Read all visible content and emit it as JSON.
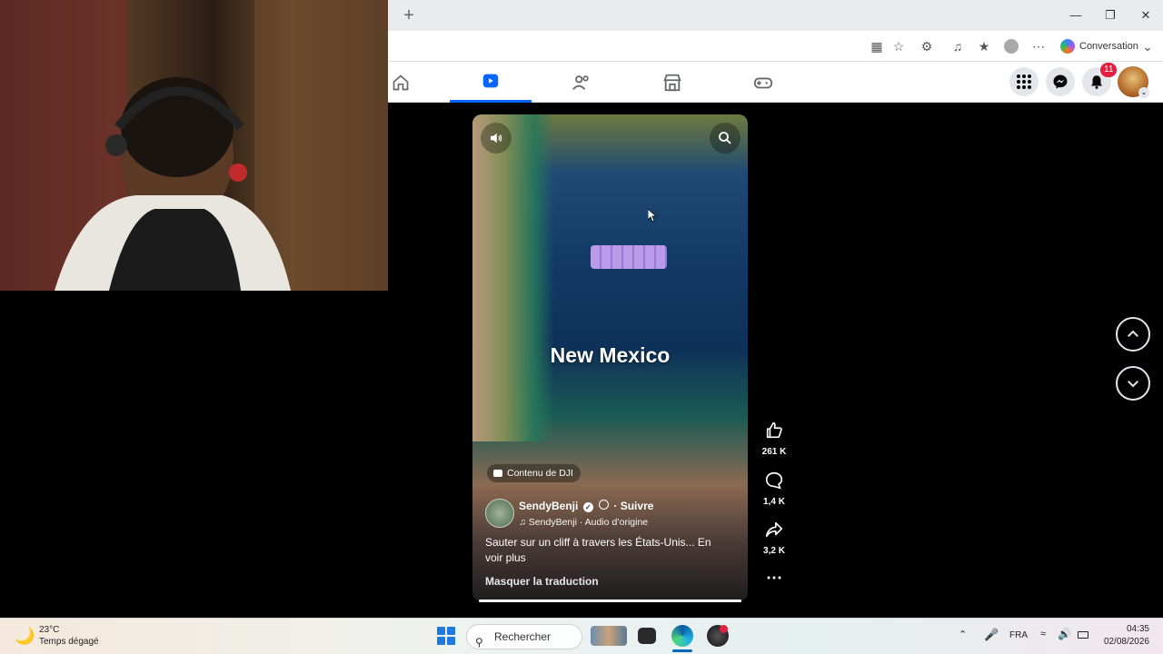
{
  "browser": {
    "new_tab_label": "+",
    "copilot_label": "Conversation",
    "window_controls": [
      "minimize-icon",
      "restore-icon",
      "close-icon"
    ]
  },
  "facebook": {
    "nav_tabs": [
      {
        "name": "home-icon",
        "active": false
      },
      {
        "name": "reels-icon",
        "active": true
      },
      {
        "name": "friends-icon",
        "active": false
      },
      {
        "name": "marketplace-icon",
        "active": false
      },
      {
        "name": "gaming-icon",
        "active": false
      }
    ],
    "notifications_count": "11",
    "accent": "#0866ff"
  },
  "reel": {
    "overlay_text": "New Mexico",
    "content_label": "Contenu de DJI",
    "author": "SendyBenji",
    "follow_label": "· Suivre",
    "audio": "SendyBenji · Audio d’origine",
    "caption": "Sauter sur un cliff à travers les États-Unis... En voir plus",
    "translation_toggle": "Masquer la traduction",
    "progress": 1.0
  },
  "actions": {
    "likes": "261 K",
    "comments": "1,4 K",
    "shares": "3,2 K"
  },
  "taskbar": {
    "weather_temp": "23°C",
    "weather_desc": "Temps dégagé",
    "search_placeholder": "Rechercher",
    "language": "FRA",
    "time": "04:35",
    "date": "02/08/2026"
  }
}
